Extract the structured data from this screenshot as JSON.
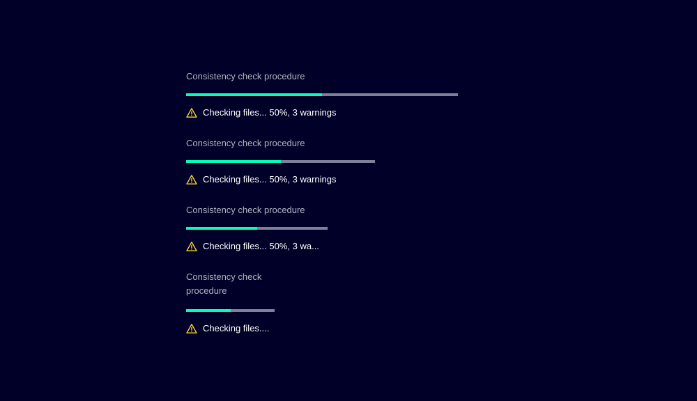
{
  "colors": {
    "background": "#000028",
    "progress_fill": "#00ffb9",
    "progress_track": "#7d8099",
    "warning": "#ffd732"
  },
  "items": [
    {
      "label": "Consistency check procedure",
      "progress_fraction": 0.5,
      "status_icon": "warning-icon",
      "status_text": "Checking files... 50%, 3 warnings"
    },
    {
      "label": "Consistency check procedure",
      "progress_fraction": 0.5,
      "status_icon": "warning-icon",
      "status_text": "Checking files... 50%, 3 warnings"
    },
    {
      "label": "Consistency check procedure",
      "progress_fraction": 0.5,
      "status_icon": "warning-icon",
      "status_text": "Checking files... 50%, 3 wa..."
    },
    {
      "label_lines": [
        "Consistency check",
        "procedure"
      ],
      "progress_fraction": 0.5,
      "status_icon": "warning-icon",
      "status_text": "Checking files...."
    }
  ]
}
